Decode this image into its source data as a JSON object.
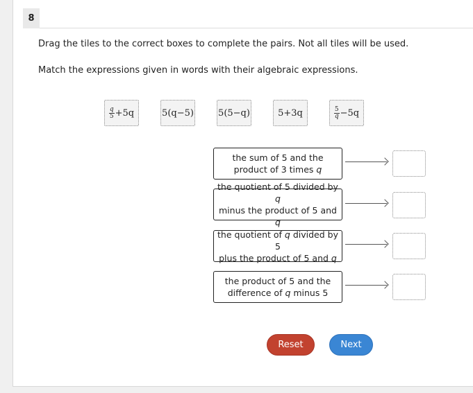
{
  "question_number": "8",
  "instructions": {
    "line1": "Drag the tiles to the correct boxes to complete the pairs. Not all tiles will be used.",
    "line2": "Match the expressions given in words with their algebraic expressions."
  },
  "tiles": [
    {
      "num": "q",
      "den": "5",
      "rest": "+5q"
    },
    {
      "expr": "5(q−5)"
    },
    {
      "expr": "5(5−q)"
    },
    {
      "expr": "5+3q"
    },
    {
      "num": "5",
      "den": "q",
      "rest": "−5q"
    }
  ],
  "prompts": [
    {
      "line1": "the sum of 5 and the",
      "line2_pre": "product of 3 times ",
      "var": "q",
      "line2_post": ""
    },
    {
      "line1_pre": "the quotient of 5 divided by ",
      "line1_var": "q",
      "line2_pre": "minus the product of 5 and ",
      "var": "q",
      "line2_post": ""
    },
    {
      "line1_pre": "the quotient of ",
      "line1_var": "q",
      "line1_post": " divided by 5",
      "line2_pre": "plus the product of 5 and ",
      "var": "q",
      "line2_post": ""
    },
    {
      "line1": "the product of 5 and the",
      "line2_pre": "difference of ",
      "var": "q",
      "line2_post": " minus 5"
    }
  ],
  "buttons": {
    "reset": "Reset",
    "next": "Next"
  },
  "colors": {
    "reset": "#c2422f",
    "next": "#3a86d4"
  }
}
